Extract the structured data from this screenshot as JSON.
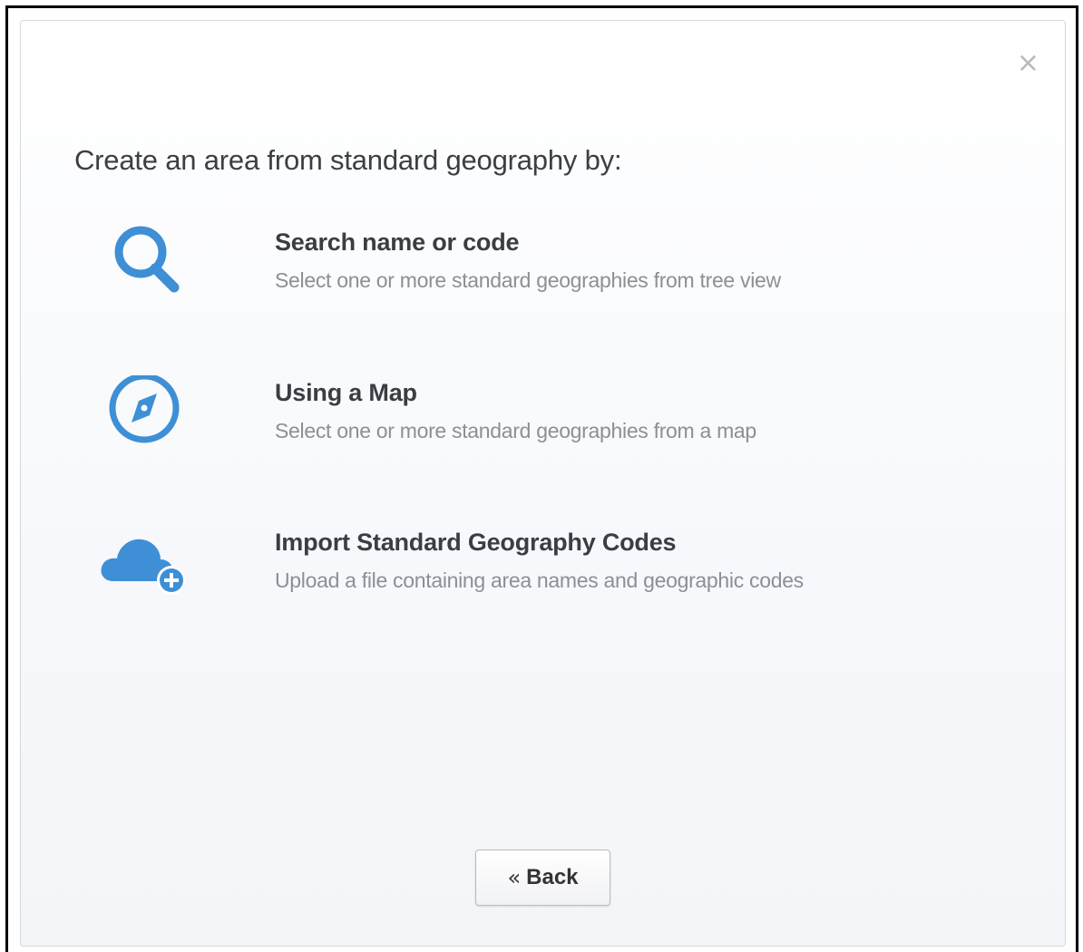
{
  "dialog": {
    "close_label": "×",
    "heading": "Create an area from standard geography by:",
    "options": [
      {
        "icon": "search-icon",
        "title": "Search name or code",
        "description": "Select one or more standard geographies from tree view"
      },
      {
        "icon": "compass-icon",
        "title": "Using a Map",
        "description": "Select one or more standard geographies from a map"
      },
      {
        "icon": "cloud-add-icon",
        "title": "Import Standard Geography Codes",
        "description": "Upload a file containing area names and geographic codes"
      }
    ],
    "back_button": {
      "chevron": "«",
      "label": "Back"
    }
  },
  "colors": {
    "accent": "#3e8fd6",
    "title_text": "#3a3e43",
    "description_text": "#8b9096"
  }
}
